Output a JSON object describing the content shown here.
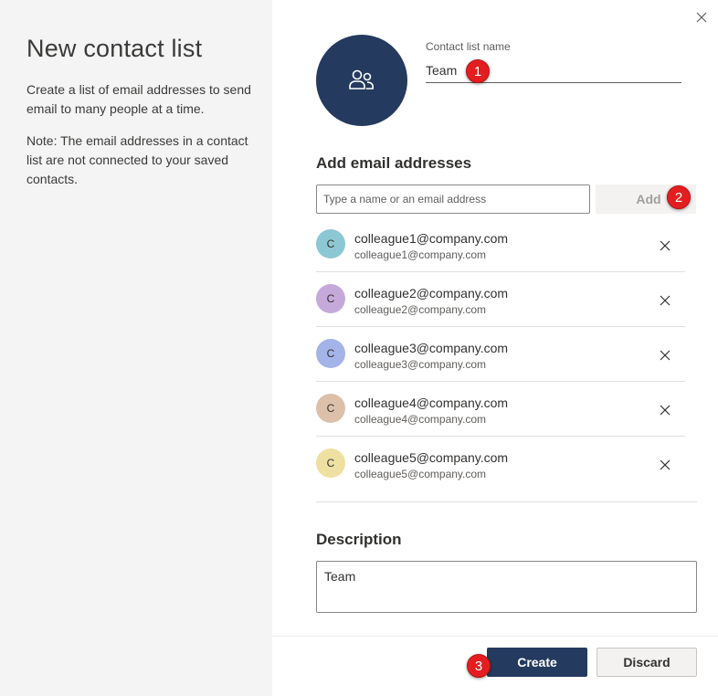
{
  "intro": {
    "title": "New contact list",
    "description": "Create a list of email addresses to send email to many people at a time.",
    "note": "Note: The email addresses in a contact list are not connected to your saved contacts."
  },
  "header": {
    "close_icon": "close-icon",
    "avatar_icon": "people-icon",
    "avatar_color": "#243a5e",
    "name_label": "Contact list name",
    "name_value": "Team"
  },
  "add_section": {
    "heading": "Add email addresses",
    "placeholder": "Type a name or an email address",
    "add_label": "Add"
  },
  "contacts": [
    {
      "initial": "C",
      "name": "colleague1@company.com",
      "email": "colleague1@company.com",
      "color": "#8cc8d3"
    },
    {
      "initial": "C",
      "name": "colleague2@company.com",
      "email": "colleague2@company.com",
      "color": "#c5a9db"
    },
    {
      "initial": "C",
      "name": "colleague3@company.com",
      "email": "colleague3@company.com",
      "color": "#a4b3e8"
    },
    {
      "initial": "C",
      "name": "colleague4@company.com",
      "email": "colleague4@company.com",
      "color": "#dcc0aa"
    },
    {
      "initial": "C",
      "name": "colleague5@company.com",
      "email": "colleague5@company.com",
      "color": "#eee0a0"
    }
  ],
  "description": {
    "heading": "Description",
    "value": "Team"
  },
  "footer": {
    "create_label": "Create",
    "discard_label": "Discard"
  },
  "markers": [
    "1",
    "2",
    "3"
  ]
}
